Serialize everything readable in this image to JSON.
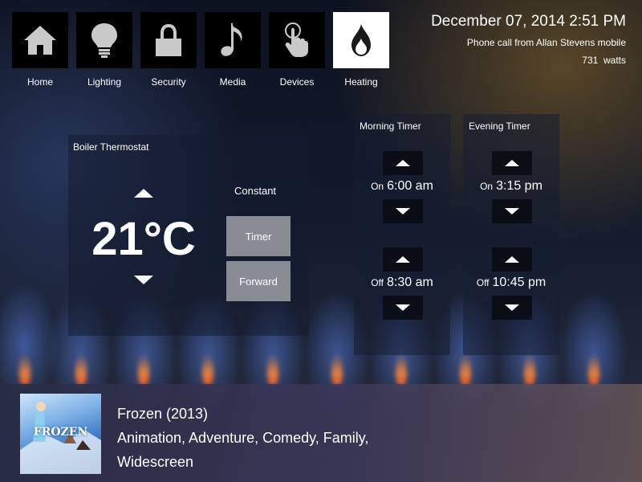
{
  "nav": {
    "items": [
      {
        "label": "Home",
        "icon": "home-icon",
        "active": false
      },
      {
        "label": "Lighting",
        "icon": "lightbulb-icon",
        "active": false
      },
      {
        "label": "Security",
        "icon": "lock-icon",
        "active": false
      },
      {
        "label": "Media",
        "icon": "music-note-icon",
        "active": false
      },
      {
        "label": "Devices",
        "icon": "touch-hand-icon",
        "active": false
      },
      {
        "label": "Heating",
        "icon": "flame-icon",
        "active": true
      }
    ]
  },
  "info": {
    "datetime": "December 07, 2014 2:51 PM",
    "notification": "Phone call from Allan Stevens mobile",
    "power": "731  watts"
  },
  "thermostat": {
    "title": "Boiler Thermostat",
    "temperature": "21°C",
    "mode_label": "Constant",
    "timer_button": "Timer",
    "forward_button": "Forward"
  },
  "morning_timer": {
    "title": "Morning Timer",
    "on_label": "On",
    "on_time": "6:00 am",
    "off_label": "Off",
    "off_time": "8:30 am"
  },
  "evening_timer": {
    "title": "Evening Timer",
    "on_label": "On",
    "on_time": "3:15 pm",
    "off_label": "Off",
    "off_time": "10:45 pm"
  },
  "now_playing": {
    "title": "Frozen (2013)",
    "genres": "Animation, Adventure, Comedy, Family,",
    "format": "Widescreen",
    "poster_text": "FROZEN"
  },
  "colors": {
    "tile_bg": "#000000",
    "active_tile_bg": "#ffffff",
    "mode_button_bg": "#8a8c94"
  }
}
